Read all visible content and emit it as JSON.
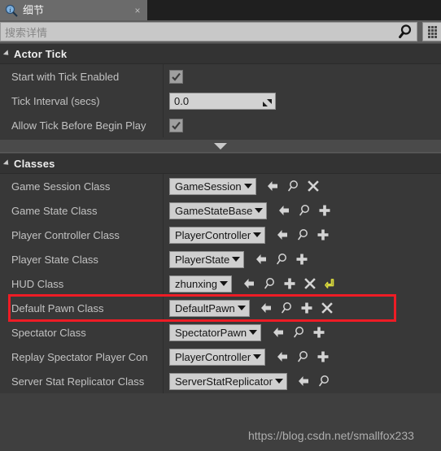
{
  "tab": {
    "icon": "details-magnifier-icon",
    "label": "细节",
    "close": "×"
  },
  "search": {
    "placeholder": "搜索详情",
    "value": "",
    "icon": "search-icon",
    "settings_icon": "grid-settings-icon"
  },
  "sections": [
    {
      "title": "Actor Tick",
      "rows": [
        {
          "label": "Start with Tick Enabled",
          "control": "checkbox",
          "checked": true,
          "actions": []
        },
        {
          "label": "Tick Interval (secs)",
          "control": "number",
          "value": "0.0",
          "actions": []
        },
        {
          "label": "Allow Tick Before Begin Play",
          "control": "checkbox",
          "checked": true,
          "actions": []
        }
      ]
    },
    {
      "title": "Classes",
      "rows": [
        {
          "label": "Game Session Class",
          "control": "combo",
          "value": "GameSession",
          "actions": [
            "back-arrow-icon",
            "browse-icon",
            "clear-icon"
          ]
        },
        {
          "label": "Game State Class",
          "control": "combo",
          "value": "GameStateBase",
          "actions": [
            "back-arrow-icon",
            "browse-icon",
            "new-asset-icon"
          ]
        },
        {
          "label": "Player Controller Class",
          "control": "combo",
          "value": "PlayerController",
          "actions": [
            "back-arrow-icon",
            "browse-icon",
            "new-asset-icon"
          ]
        },
        {
          "label": "Player State Class",
          "control": "combo",
          "value": "PlayerState",
          "actions": [
            "back-arrow-icon",
            "browse-icon",
            "new-asset-icon"
          ]
        },
        {
          "label": "HUD Class",
          "control": "combo",
          "value": "zhunxing",
          "actions": [
            "back-arrow-icon",
            "browse-icon",
            "new-asset-icon",
            "clear-icon",
            "reset-to-default-icon"
          ]
        },
        {
          "label": "Default Pawn Class",
          "control": "combo",
          "value": "DefaultPawn",
          "actions": [
            "back-arrow-icon",
            "browse-icon",
            "new-asset-icon",
            "clear-icon"
          ],
          "highlighted": true
        },
        {
          "label": "Spectator Class",
          "control": "combo",
          "value": "SpectatorPawn",
          "actions": [
            "back-arrow-icon",
            "browse-icon",
            "new-asset-icon"
          ]
        },
        {
          "label": "Replay Spectator Player Con",
          "control": "combo",
          "value": "PlayerController",
          "actions": [
            "back-arrow-icon",
            "browse-icon",
            "new-asset-icon"
          ]
        },
        {
          "label": "Server Stat Replicator Class",
          "control": "combo",
          "value": "ServerStatReplicator",
          "actions": [
            "back-arrow-icon",
            "browse-icon"
          ]
        }
      ]
    }
  ],
  "expand_more": {
    "icon": "expand-more-icon"
  },
  "watermark": {
    "text": "https://blog.csdn.net/smallfox233"
  },
  "colors": {
    "highlight": "#ee1c25",
    "panel_bg": "#383838",
    "section_bg": "#333333",
    "tab_active": "#6b6b6b",
    "reset_icon": "#d6d63c"
  }
}
